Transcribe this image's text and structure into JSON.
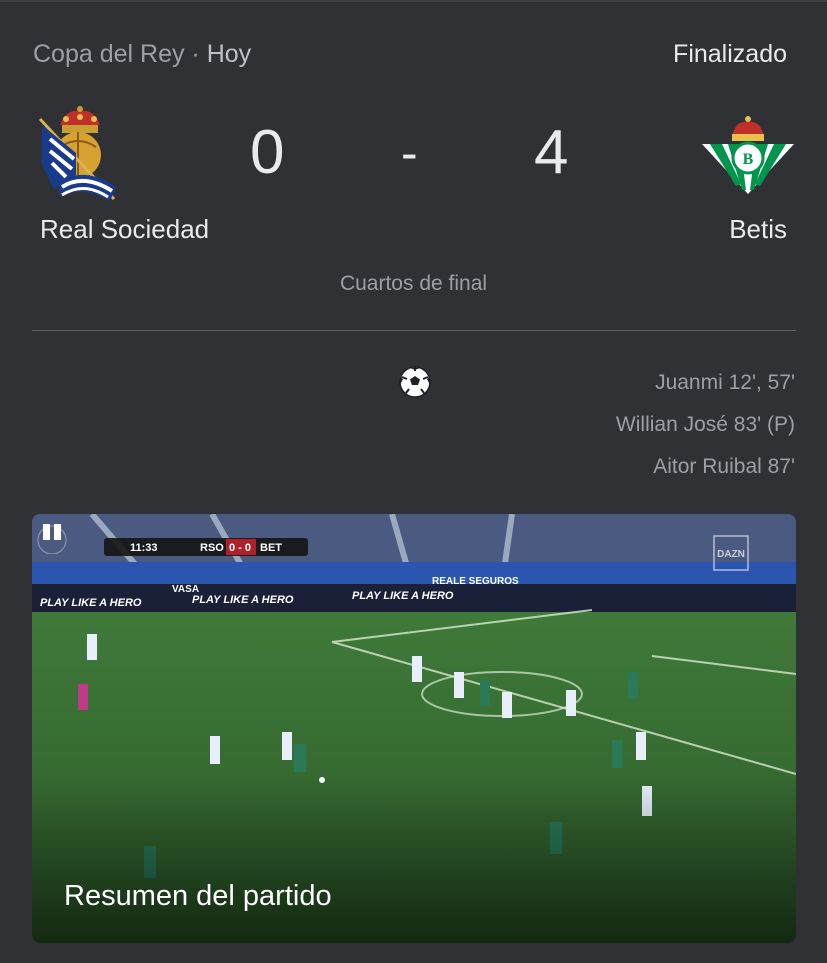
{
  "header": {
    "competition": "Copa del Rey",
    "separator": " · ",
    "date": "Hoy",
    "status": "Finalizado"
  },
  "match": {
    "home_team": "Real Sociedad",
    "away_team": "Betis",
    "home_score": "0",
    "score_separator": "-",
    "away_score": "4",
    "round": "Cuartos de final"
  },
  "scorers": {
    "icon": "soccer-ball-icon",
    "away": [
      "Juanmi 12', 57'",
      "Willian José 83' (P)",
      "Aitor Ruibal 87'"
    ]
  },
  "video": {
    "title": "Resumen del partido",
    "scoreboard": {
      "time": "11:33",
      "home": "RSO",
      "score": "0 - 0",
      "away": "BET"
    },
    "watermark": "DAZN",
    "ad_board": "PLAY LIKE A HERO",
    "ad_vasa": "VASA",
    "ad_reale": "REALE SEGUROS",
    "icon": "pause-icon"
  },
  "colors": {
    "background": "#303134",
    "text_primary": "#e8eaed",
    "text_secondary": "#9aa0a6",
    "real_sociedad_blue": "#1a3a8c",
    "betis_green": "#00954c"
  }
}
